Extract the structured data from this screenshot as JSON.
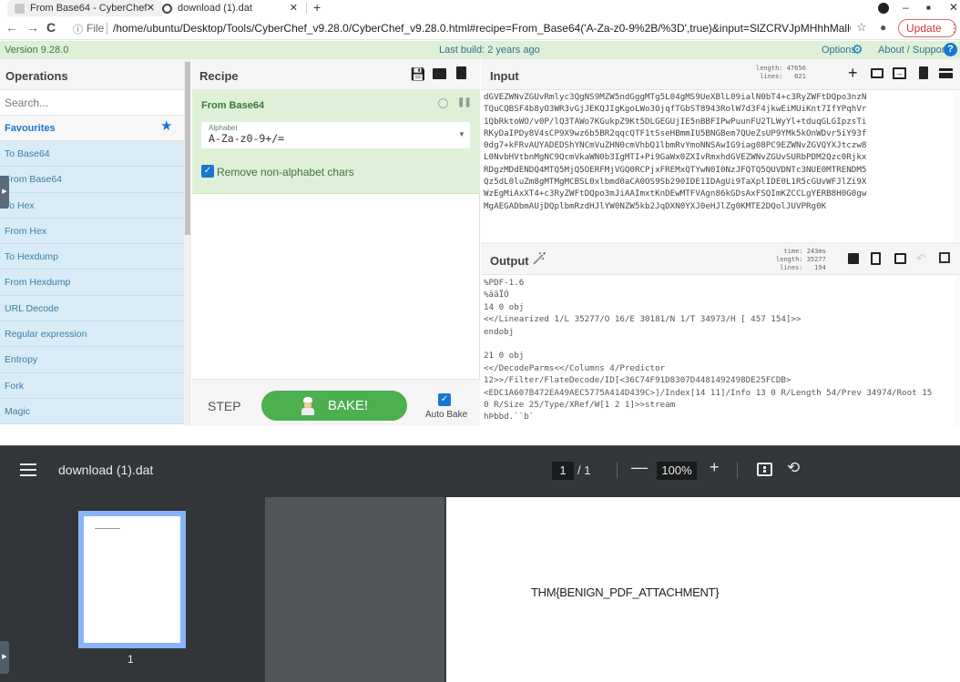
{
  "browser": {
    "tabs": [
      {
        "title": "From Base64 - CyberChef",
        "icon": "cyberchef-icon",
        "active": true
      },
      {
        "title": "download (1).dat",
        "icon": "globe-icon",
        "active": false
      }
    ],
    "new_tab": "+",
    "url_scheme": "File",
    "url": "/home/ubuntu/Desktop/Tools/CyberChef_v9.28.0/CyberChef_v9.28.0.html#recipe=From_Base64('A-Za-z0-9%2B/%3D',true)&input=SlZCRVJpMHhhMallOSmVManoST...",
    "update_label": "Update",
    "window_controls": [
      "minimize",
      "maximize",
      "close"
    ]
  },
  "banner": {
    "version": "Version 9.28.0",
    "last_build": "Last build: 2 years ago",
    "options": "Options",
    "about": "About / Support"
  },
  "operations": {
    "title": "Operations",
    "search_placeholder": "Search...",
    "favourites": "Favourites",
    "items": [
      "To Base64",
      "From Base64",
      "To Hex",
      "From Hex",
      "To Hexdump",
      "From Hexdump",
      "URL Decode",
      "Regular expression",
      "Entropy",
      "Fork",
      "Magic"
    ]
  },
  "recipe": {
    "title": "Recipe",
    "ingredient": {
      "name": "From Base64",
      "alphabet_label": "Alphabet",
      "alphabet_value": "A-Za-z0-9+/=",
      "remove_label": "Remove non-alphabet chars",
      "remove_checked": true
    },
    "step_label": "STEP",
    "bake_label": "BAKE!",
    "autobake_label": "Auto Bake",
    "autobake_checked": true
  },
  "input": {
    "title": "Input",
    "stats": "length: 47656\n lines:   621",
    "text": "dGVEZWNvZGUvRmlyc3QgNS9MZW5ndGggMTg5L04gMS9UeXBlL09ialN0bT4+c3RyZWFtDQpo3nzN\nTQuCQBSF4b8yO3WR3vGjJEKQJIgKgoLWo3OjqfTGbST8943RolW7d3F4jkwEiMUiKnt7IfYPqhVr\n1QbRktoWO/v0P/lQ3TAWo7KGukpZ9Kt5DLGEGUjIE5nBBFIPwPuunFU2TLWyYl+tduqGLGIpzsTi\nRKyDaIPDy8V4sCP9X9wz6b5BR2qqcQTF1tSseHBmmIU5BNGBem7QUeZsUP9YMk5kOnWDvr5iY93f\n0dg7+kFRvAUYADEDShYNCmVuZHN0cmVhbQ1lbmRvYmoNNSAwIG9iag08PC9EZWNvZGVQYXJtczw8\nL0NvbHVtbnMgNC9QcmVkaWN0b3IgMTI+Pi9GaWx0ZXIvRmxhdGVEZWNvZGUvSURbPDM2Qzc0Rjkx\nRDgzMDdENDQ4MTQ5MjQ5OERFMjVGQ0RCPjxFREMxQTYwN0I0NzJFQTQ5QUVDNTc3NUE0MTRENDM5\nQz5dL0luZm8gMTMgMCBSL0xlbmd0aCA0OS9Sb290IDE1IDAgUi9TaXplIDE0L1R5cGUvWFJlZi9X\nWzEgMiAxXT4+c3RyZWFtDQpo3mJiAAImxtKnDEwMTFVAgn86kGDsAxFSQImKZCCLgYERB8H0G0gw\nMgAEGADbmAUjDQplbmRzdHJlYW0NZW5kb2JqDXN0YXJ0eHJlZg0KMTE2DQolJUVPRg0K"
  },
  "output": {
    "title": "Output",
    "stats": "  time: 243ms\nlength: 35277\n lines:   194",
    "text": "%PDF-1.6\n%âãÏÓ\n14 0 obj\n<</Linearized 1/L 35277/O 16/E 30181/N 1/T 34973/H [ 457 154]>>\nendobj\n\n21 0 obj\n<</DecodeParms<</Columns 4/Predictor\n12>>/Filter/FlateDecode/ID[<36C74F91D8307D4481492498DE25FCDB>\n<EDC1A607B472EA49AEC5775A414D439C>]/Index[14 11]/Info 13 0 R/Length 54/Prev 34974/Root 15\n0 R/Size 25/Type/XRef/W[1 2 1]>>stream\nhÞbbd.``b`"
  },
  "pdf_viewer": {
    "title": "download (1).dat",
    "current_page": "1",
    "page_total": "/ 1",
    "zoom": "100%",
    "thumbnail_label": "1",
    "page_text": "THM{BENIGN_PDF_ATTACHMENT}"
  }
}
